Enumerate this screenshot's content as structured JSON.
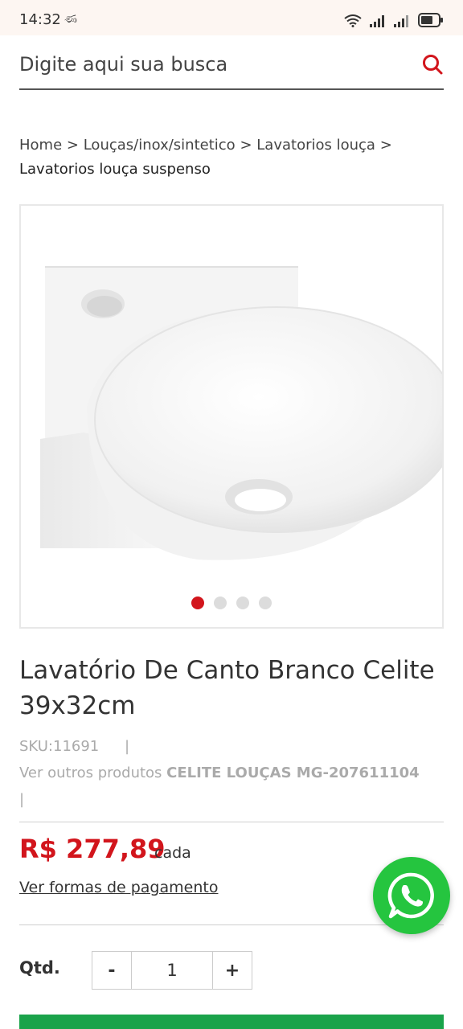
{
  "status_bar": {
    "time": "14:32",
    "extra": "ණ"
  },
  "search": {
    "placeholder": "Digite aqui sua busca"
  },
  "breadcrumb": {
    "items": [
      "Home",
      "Louças/inox/sintetico",
      "Lavatorios louça"
    ],
    "separator": ">",
    "current": "Lavatorios louça suspenso"
  },
  "gallery": {
    "total_images": 4,
    "active_index": 0
  },
  "product": {
    "title": "Lavatório De Canto Branco Celite 39x32cm",
    "sku": "SKU:11691",
    "meta_separator": "|",
    "see_other_prefix": "Ver outros produtos",
    "brand": "CELITE LOUÇAS MG-207611104",
    "price": "R$ 277,89",
    "price_unit": "cada",
    "payment_link": "Ver formas de pagamento"
  },
  "quantity": {
    "label": "Qtd.",
    "minus": "-",
    "value": "1",
    "plus": "+"
  },
  "colors": {
    "accent": "#d2151c",
    "whatsapp": "#25c53f",
    "buy": "#1aa34a"
  }
}
